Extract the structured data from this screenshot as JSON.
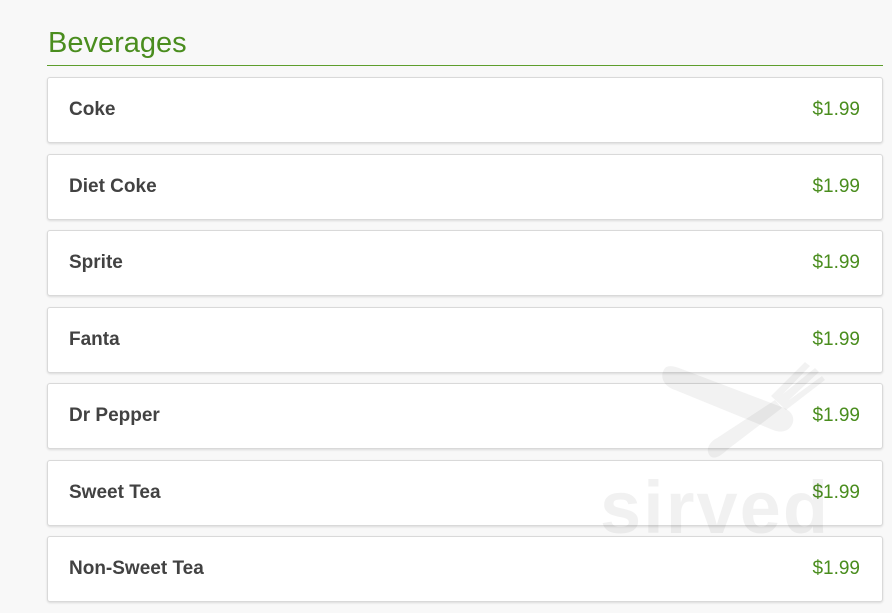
{
  "section": {
    "title": "Beverages"
  },
  "items": [
    {
      "name": "Coke",
      "price": "$1.99"
    },
    {
      "name": "Diet Coke",
      "price": "$1.99"
    },
    {
      "name": "Sprite",
      "price": "$1.99"
    },
    {
      "name": "Fanta",
      "price": "$1.99"
    },
    {
      "name": "Dr Pepper",
      "price": "$1.99"
    },
    {
      "name": "Sweet Tea",
      "price": "$1.99"
    },
    {
      "name": "Non-Sweet Tea",
      "price": "$1.99"
    }
  ],
  "watermark": {
    "text": "sirved",
    "icon": "fork-knife-icon"
  },
  "colors": {
    "accent": "#4a8d1e",
    "item_text": "#424242",
    "background": "#f8f8f8"
  }
}
